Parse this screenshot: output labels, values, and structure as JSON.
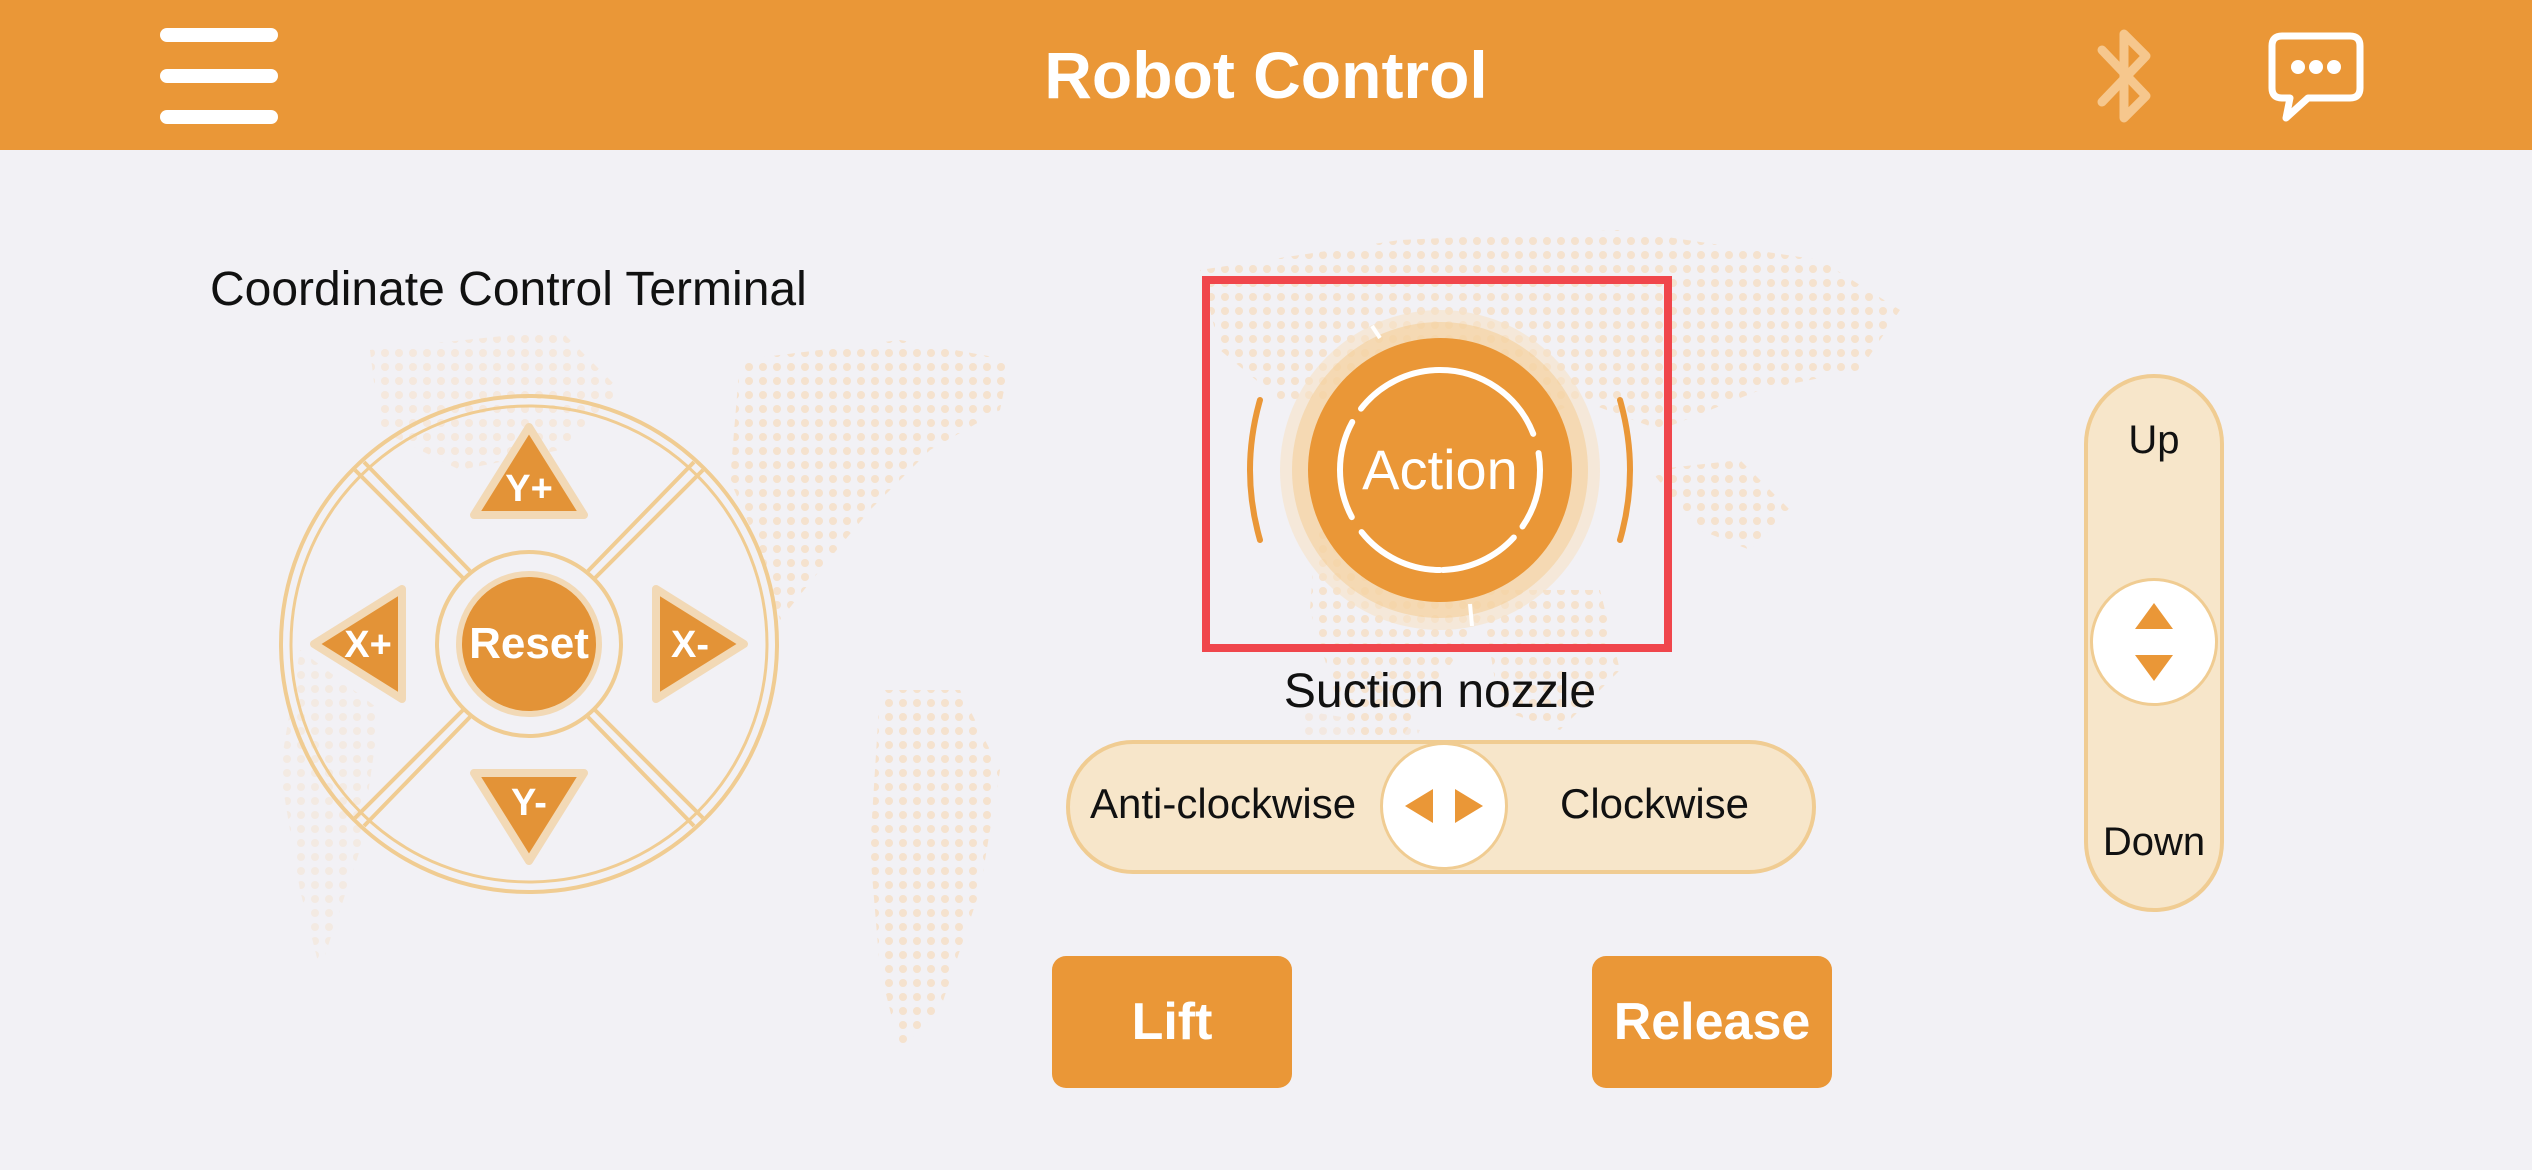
{
  "header": {
    "title": "Robot Control",
    "menu_icon": "menu-icon",
    "bluetooth_icon": "bluetooth-icon",
    "chat_icon": "chat-bubble-icon"
  },
  "colors": {
    "accent": "#ea9737",
    "light_accent": "#f7e6ca",
    "track_border": "#f0cc92",
    "highlight_box": "#f0464c",
    "background": "#f2f1f5"
  },
  "coordinate_terminal": {
    "label": "Coordinate Control Terminal",
    "buttons": {
      "y_plus": "Y+",
      "y_minus": "Y-",
      "x_plus": "X+",
      "x_minus": "X-",
      "reset": "Reset"
    }
  },
  "suction": {
    "action_label": "Action",
    "label": "Suction nozzle",
    "rotate_left": "Anti-clockwise",
    "rotate_right": "Clockwise"
  },
  "vertical": {
    "up": "Up",
    "down": "Down"
  },
  "actions": {
    "lift": "Lift",
    "release": "Release"
  }
}
